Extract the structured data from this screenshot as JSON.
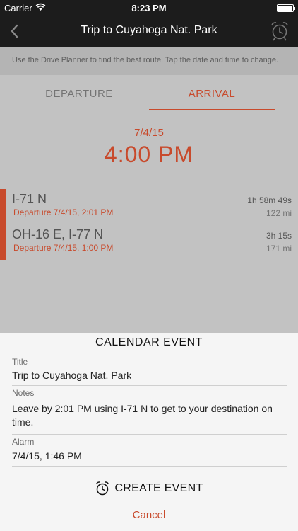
{
  "status_bar": {
    "carrier": "Carrier",
    "time": "8:23 PM"
  },
  "nav": {
    "title": "Trip to Cuyahoga Nat. Park"
  },
  "hint": "Use the Drive Planner to find the best route. Tap the date and time to change.",
  "tabs": [
    {
      "label": "DEPARTURE",
      "selected": false
    },
    {
      "label": "ARRIVAL",
      "selected": true
    }
  ],
  "selected": {
    "date": "7/4/15",
    "time": "4:00 PM"
  },
  "routes": [
    {
      "name": "I-71 N",
      "departure": "Departure 7/4/15, 2:01 PM",
      "duration": "1h 58m 49s",
      "distance": "122 mi"
    },
    {
      "name": "OH-16 E, I-77 N",
      "departure": "Departure 7/4/15, 1:00 PM",
      "duration": "3h 15s",
      "distance": "171 mi"
    }
  ],
  "sheet": {
    "title": "CALENDAR EVENT",
    "title_label": "Title",
    "title_value": "Trip to Cuyahoga Nat. Park",
    "notes_label": "Notes",
    "notes_value": "Leave by 2:01 PM using I-71 N to get to your destination on time.",
    "alarm_label": "Alarm",
    "alarm_value": "7/4/15, 1:46 PM",
    "create_label": "CREATE EVENT",
    "cancel_label": "Cancel"
  },
  "colors": {
    "accent": "#c84a2c",
    "nav_bg": "#1c1c1c",
    "dim_bg": "#c2c2c2",
    "sheet_bg": "#f5f5f5"
  },
  "icons": [
    "wifi-icon",
    "battery-icon",
    "back-chevron-icon",
    "alarm-clock-icon"
  ]
}
